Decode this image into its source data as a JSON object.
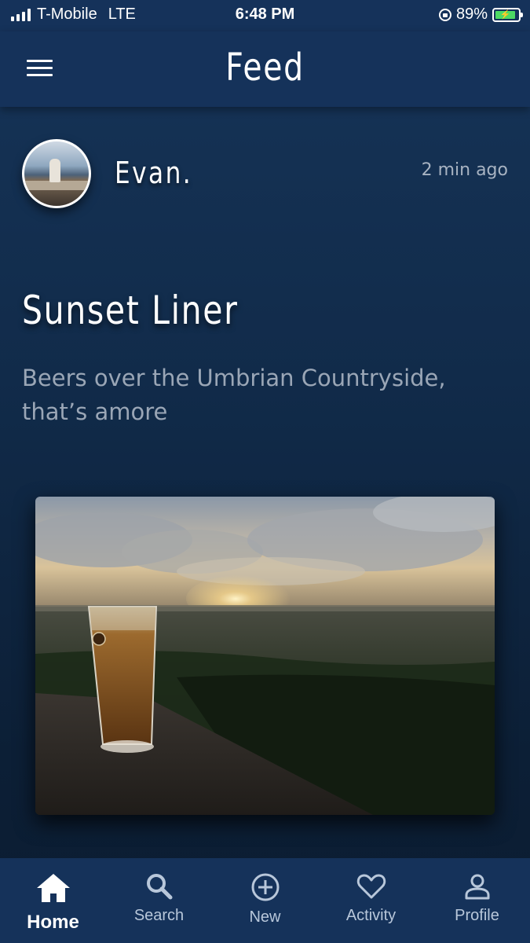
{
  "status_bar": {
    "carrier": "T-Mobile",
    "network": "LTE",
    "time": "6:48 PM",
    "battery_percent": "89%",
    "battery_level": 0.89,
    "signal_bars": 4
  },
  "header": {
    "title": "Feed",
    "menu_icon": "hamburger-menu-icon"
  },
  "post": {
    "author": "Evan.",
    "timestamp": "2 min ago",
    "title": "Sunset Liner",
    "caption": "Beers over the Umbrian Countryside, that’s amore"
  },
  "tabs": [
    {
      "label": "Home",
      "icon": "home-icon",
      "active": true
    },
    {
      "label": "Search",
      "icon": "search-icon",
      "active": false
    },
    {
      "label": "New",
      "icon": "plus-circle-icon",
      "active": false
    },
    {
      "label": "Activity",
      "icon": "heart-icon",
      "active": false
    },
    {
      "label": "Profile",
      "icon": "person-icon",
      "active": false
    }
  ],
  "colors": {
    "bar_background": "#15325a",
    "page_background": "#112b4a",
    "battery_green": "#4cd964"
  }
}
